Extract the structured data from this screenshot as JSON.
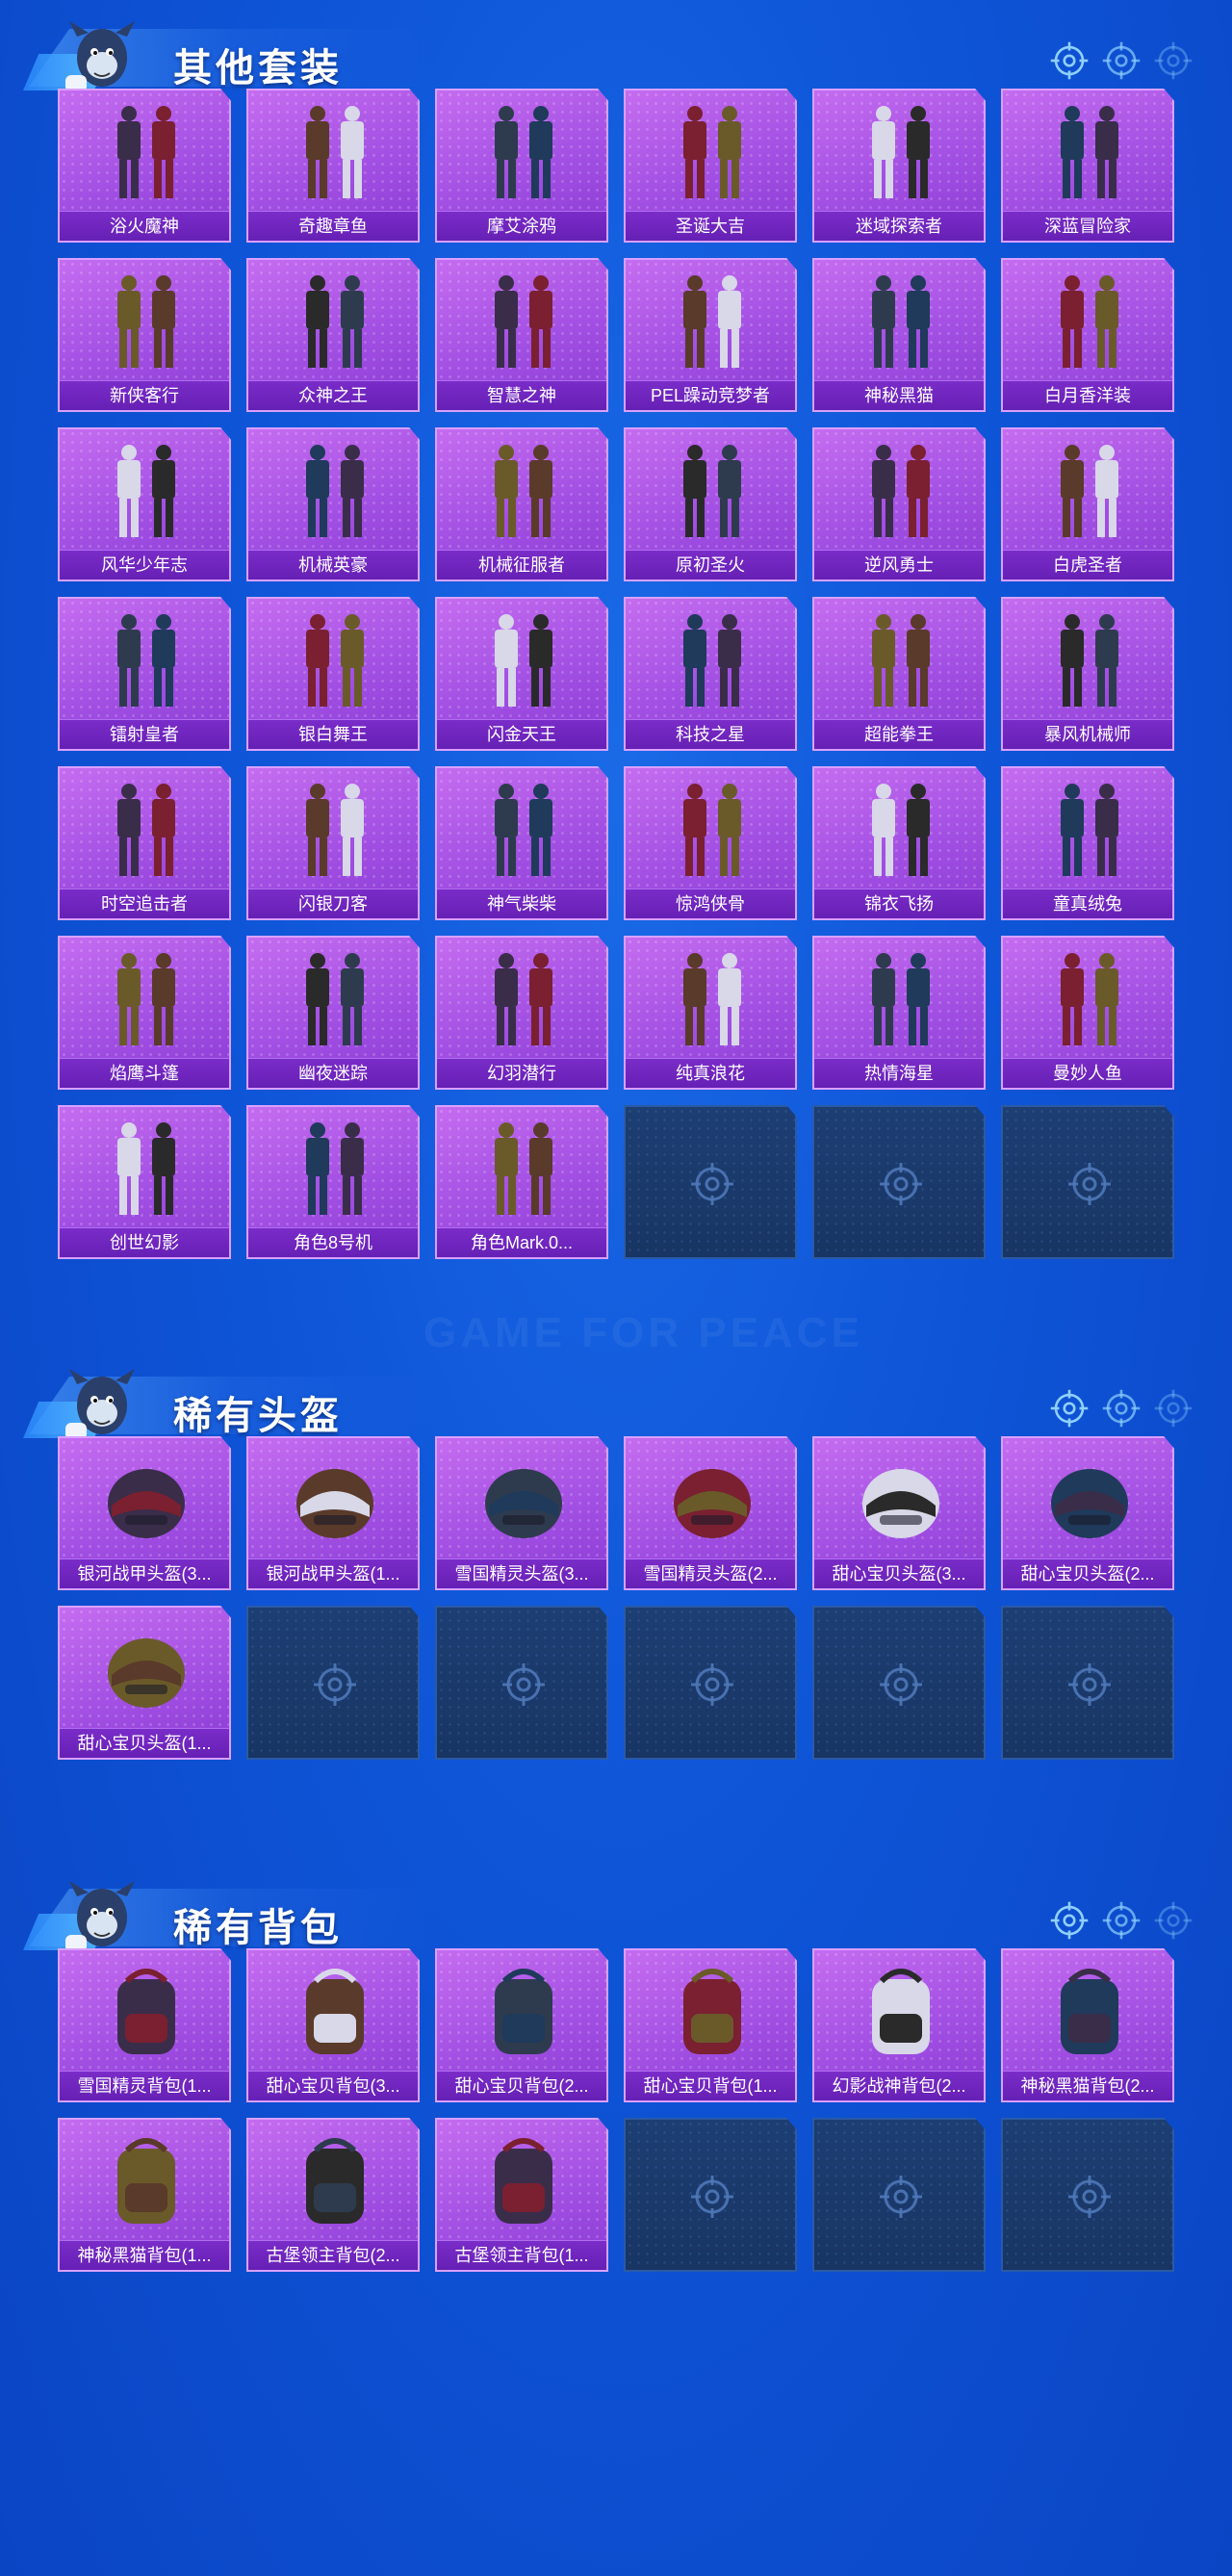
{
  "sections": [
    {
      "title": "其他套装",
      "items": [
        "浴火魔神",
        "奇趣章鱼",
        "摩艾涂鸦",
        "圣诞大吉",
        "迷域探索者",
        "深蓝冒险家",
        "新侠客行",
        "众神之王",
        "智慧之神",
        "PEL躁动竞梦者",
        "神秘黑猫",
        "白月香洋装",
        "风华少年志",
        "机械英豪",
        "机械征服者",
        "原初圣火",
        "逆风勇士",
        "白虎圣者",
        "镭射皇者",
        "银白舞王",
        "闪金天王",
        "科技之星",
        "超能拳王",
        "暴风机械师",
        "时空追击者",
        "闪银刀客",
        "神气柴柴",
        "惊鸿侠骨",
        "锦衣飞扬",
        "童真绒兔",
        "焰鹰斗篷",
        "幽夜迷踪",
        "幻羽潜行",
        "纯真浪花",
        "热情海星",
        "曼妙人鱼",
        "创世幻影",
        "角色8号机",
        "角色Mark.0..."
      ],
      "empty_slots": 3
    },
    {
      "title": "稀有头盔",
      "items": [
        "银河战甲头盔(3...",
        "银河战甲头盔(1...",
        "雪国精灵头盔(3...",
        "雪国精灵头盔(2...",
        "甜心宝贝头盔(3...",
        "甜心宝贝头盔(2...",
        "甜心宝贝头盔(1..."
      ],
      "empty_slots": 5
    },
    {
      "title": "稀有背包",
      "items": [
        "雪国精灵背包(1...",
        "甜心宝贝背包(3...",
        "甜心宝贝背包(2...",
        "甜心宝贝背包(1...",
        "幻影战神背包(2...",
        "神秘黑猫背包(2...",
        "神秘黑猫背包(1...",
        "古堡领主背包(2...",
        "古堡领主背包(1..."
      ],
      "empty_slots": 3
    }
  ],
  "watermark": "GAME FOR PEACE",
  "colors": {
    "card": "#a24fe3",
    "label": "#6620b5",
    "empty": "#183563",
    "background": "#0f56d9"
  }
}
